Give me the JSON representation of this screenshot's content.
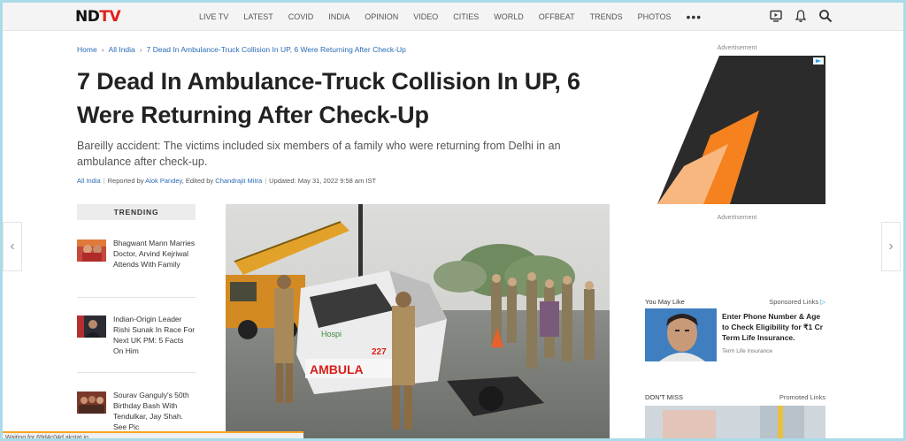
{
  "header": {
    "logo": {
      "part1": "ND",
      "part2": "TV"
    },
    "nav": [
      "LIVE TV",
      "LATEST",
      "COVID",
      "INDIA",
      "OPINION",
      "VIDEO",
      "CITIES",
      "WORLD",
      "OFFBEAT",
      "TRENDS",
      "PHOTOS"
    ],
    "more": "•••"
  },
  "breadcrumb": {
    "home": "Home",
    "section": "All India",
    "current": "7 Dead In Ambulance-Truck Collision In UP, 6 Were Returning After Check-Up"
  },
  "article": {
    "title": "7 Dead In Ambulance-Truck Collision In UP, 6 Were Returning After Check-Up",
    "summary": "Bareilly accident: The victims included six members of a family who were returning from Delhi in an ambulance after check-up.",
    "section": "All India",
    "reported_by_label": "Reported by",
    "reporter": "Alok Pandey",
    "edited_by_label": "Edited by",
    "editor": "Chandrajit Mitra",
    "updated": "Updated: May 31, 2022 9:58 am IST",
    "hero_text": {
      "van": "AMBULA",
      "number": "227",
      "brand": "Hospi"
    }
  },
  "trending": {
    "heading": "TRENDING",
    "items": [
      {
        "text": "Bhagwant Mann Marries Doctor, Arvind Kejriwal Attends With Family"
      },
      {
        "text": "Indian-Origin Leader Rishi Sunak In Race For Next UK PM: 5 Facts On Him"
      },
      {
        "text": "Sourav Ganguly's 50th Birthday Bash With Tendulkar, Jay Shah. See Pic"
      }
    ]
  },
  "sidebar": {
    "ad_label_top": "Advertisement",
    "ad_label_bottom": "Advertisement",
    "you_may_like": "You May Like",
    "sponsored_links": "Sponsored Links",
    "promo_title": "Enter Phone Number & Age to Check Eligibility for ₹1 Cr Term Life Insurance.",
    "promo_source": "Term Life Insurance",
    "dont_miss": "DON'T MISS",
    "promoted_links": "Promoted Links"
  },
  "status": {
    "text": "Waiting for 69d4c04d.akstat.io..."
  },
  "colors": {
    "brand_red": "#e0201b",
    "link_blue": "#2a6bb5",
    "ad_orange": "#f5821f",
    "status_orange": "#f5a623"
  }
}
